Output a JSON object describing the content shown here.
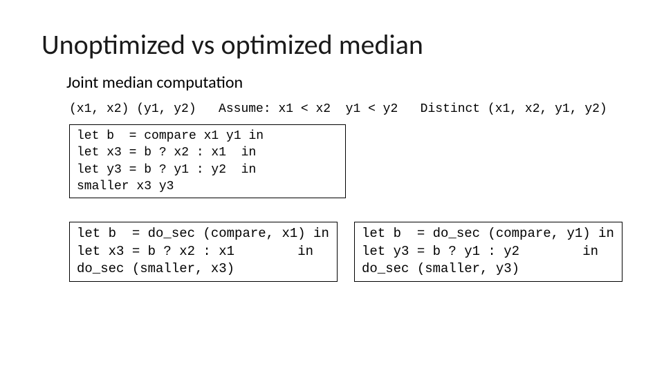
{
  "title": "Unoptimized vs optimized median",
  "subtitle": "Joint median computation",
  "assumptions": "(x1, x2) (y1, y2)   Assume: x1 < x2  y1 < y2   Distinct (x1, x2, y1, y2)",
  "code_top": "let b  = compare x1 y1 in\nlet x3 = b ? x2 : x1  in\nlet y3 = b ? y1 : y2  in\nsmaller x3 y3",
  "code_left": "let b  = do_sec (compare, x1) in\nlet x3 = b ? x2 : x1        in\ndo_sec (smaller, x3)",
  "code_right": "let b  = do_sec (compare, y1) in\nlet y3 = b ? y1 : y2        in\ndo_sec (smaller, y3)"
}
